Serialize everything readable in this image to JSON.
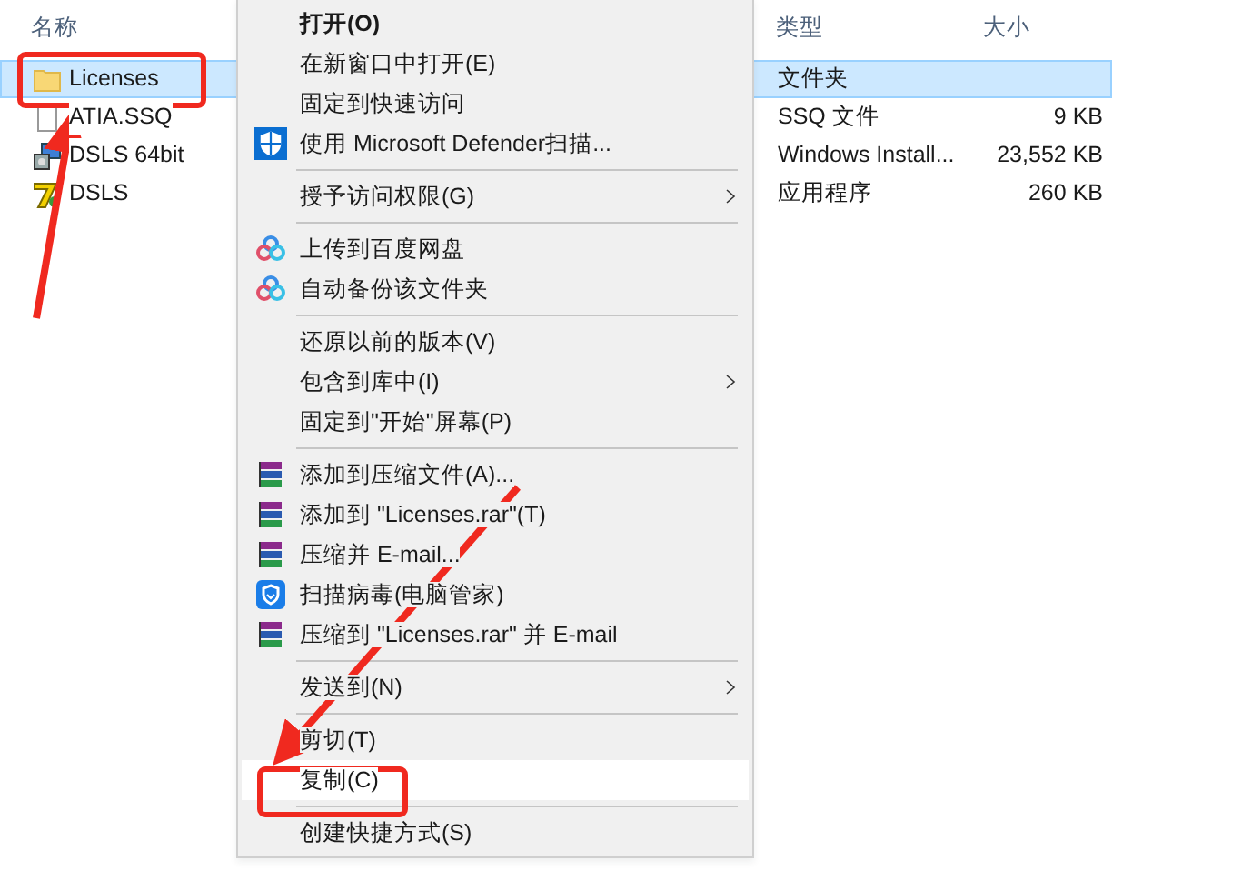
{
  "columns": [
    {
      "label": "名称"
    },
    {
      "label": "类型"
    },
    {
      "label": "大小"
    }
  ],
  "files": [
    {
      "kind": "folder",
      "name": "Licenses",
      "type": "文件夹",
      "selected": true
    },
    {
      "kind": "file",
      "name": "ATIA.SSQ",
      "type": "SSQ 文件",
      "size": "9 KB",
      "selected": false
    },
    {
      "kind": "installer",
      "name": "DSLS 64bit",
      "type": "Windows Install...",
      "size": "23,552 KB",
      "selected": false
    },
    {
      "kind": "app",
      "name": "DSLS",
      "type": "应用程序",
      "size": "260 KB",
      "selected": false
    }
  ],
  "context_menu": [
    {
      "kind": "plain",
      "label": "打开(O)",
      "bold": true,
      "selected": false
    },
    {
      "kind": "plain",
      "label": "在新窗口中打开(E)",
      "selected": false
    },
    {
      "kind": "plain",
      "label": "固定到快速访问",
      "selected": false
    },
    {
      "kind": "shield",
      "label": "使用 Microsoft Defender扫描...",
      "selected": false
    },
    {
      "kind": "separator"
    },
    {
      "kind": "plain",
      "label": "授予访问权限(G)",
      "submenu": true,
      "selected": false
    },
    {
      "kind": "separator"
    },
    {
      "kind": "cloud",
      "label": "上传到百度网盘",
      "selected": false
    },
    {
      "kind": "cloud",
      "label": "自动备份该文件夹",
      "selected": false
    },
    {
      "kind": "separator"
    },
    {
      "kind": "plain",
      "label": "还原以前的版本(V)",
      "selected": false
    },
    {
      "kind": "plain",
      "label": "包含到库中(I)",
      "submenu": true,
      "selected": false
    },
    {
      "kind": "plain",
      "label": "固定到\"开始\"屏幕(P)",
      "selected": false
    },
    {
      "kind": "separator"
    },
    {
      "kind": "archive",
      "label": "添加到压缩文件(A)...",
      "selected": false
    },
    {
      "kind": "archive",
      "label": "添加到 \"Licenses.rar\"(T)",
      "selected": false
    },
    {
      "kind": "archive",
      "label": "压缩并 E-mail...",
      "selected": false
    },
    {
      "kind": "guard",
      "label": "扫描病毒(电脑管家)",
      "selected": false
    },
    {
      "kind": "archive",
      "label": "压缩到 \"Licenses.rar\" 并 E-mail",
      "selected": false
    },
    {
      "kind": "separator"
    },
    {
      "kind": "plain",
      "label": "发送到(N)",
      "submenu": true,
      "selected": false
    },
    {
      "kind": "separator"
    },
    {
      "kind": "plain",
      "label": "剪切(T)",
      "selected": false
    },
    {
      "kind": "plain",
      "label": "复制(C)",
      "selected": true
    },
    {
      "kind": "separator"
    },
    {
      "kind": "plain",
      "label": "创建快捷方式(S)",
      "selected": false
    }
  ]
}
